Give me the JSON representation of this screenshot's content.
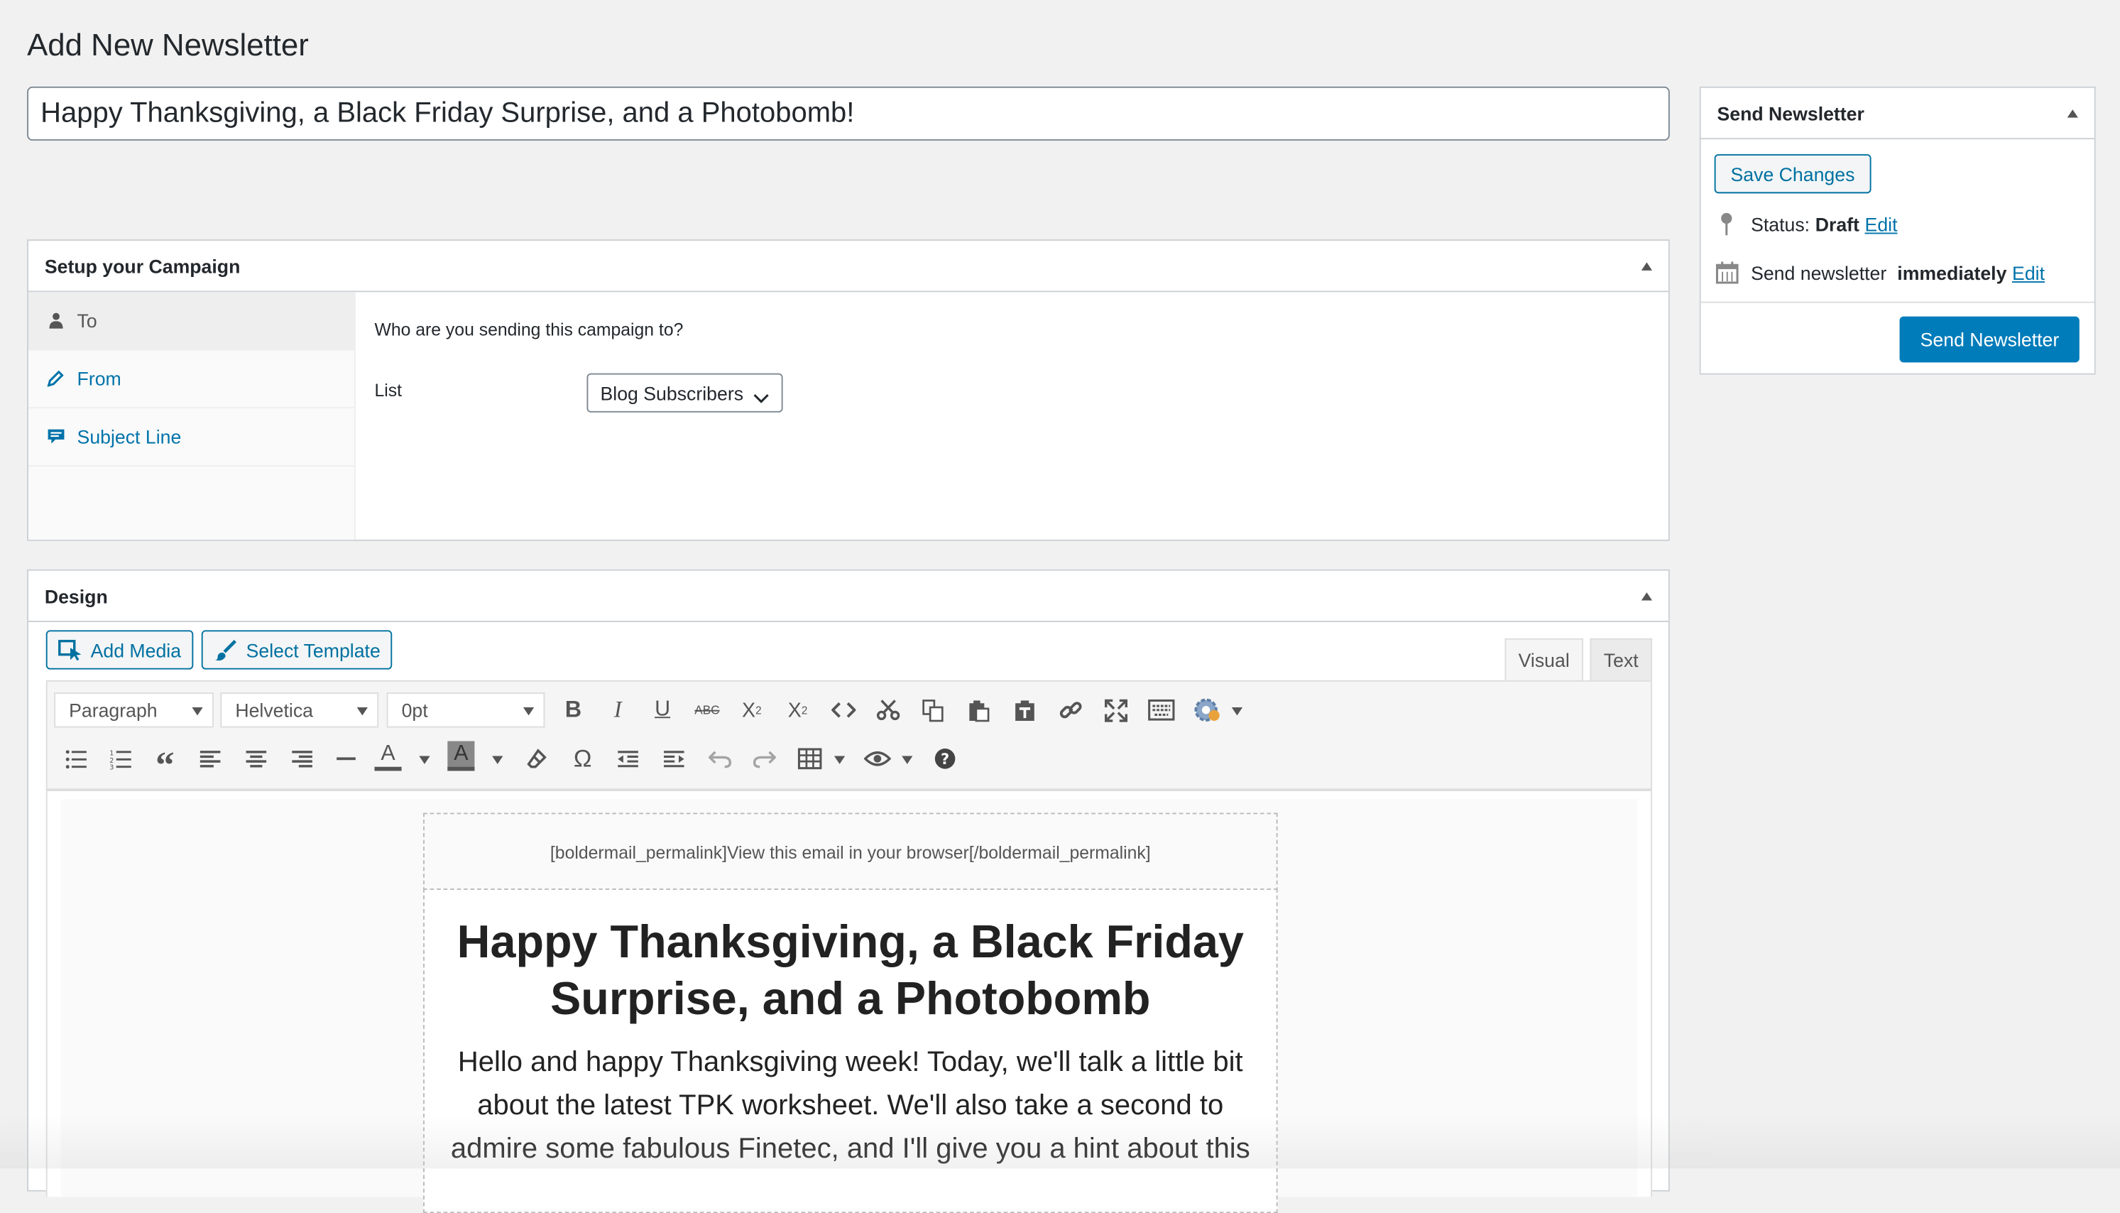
{
  "page": {
    "title": "Add New Newsletter"
  },
  "title_input": {
    "value": "Happy Thanksgiving, a Black Friday Surprise, and a Photobomb!"
  },
  "setup": {
    "heading": "Setup your Campaign",
    "tabs": [
      {
        "label": "To",
        "icon": "person-icon"
      },
      {
        "label": "From",
        "icon": "pencil-icon"
      },
      {
        "label": "Subject Line",
        "icon": "comment-icon"
      }
    ],
    "question": "Who are you sending this campaign to?",
    "list_label": "List",
    "list_value": "Blog Subscribers"
  },
  "design": {
    "heading": "Design",
    "add_media": "Add Media",
    "select_template": "Select Template",
    "tab_visual": "Visual",
    "tab_text": "Text",
    "format_select": "Paragraph",
    "font_select": "Helvetica",
    "size_select": "0pt",
    "email": {
      "header_text": "[boldermail_permalink]View this email in your browser[/boldermail_permalink]",
      "title": "Happy Thanksgiving, a Black Friday Surprise, and a Photobomb",
      "body": "Hello and happy Thanksgiving week! Today, we'll talk a little bit about the latest TPK worksheet. We'll also take a second to admire some fabulous Finetec, and I'll give you a hint about this"
    }
  },
  "send_box": {
    "heading": "Send Newsletter",
    "save_label": "Save Changes",
    "status_label": "Status: ",
    "status_value": "Draft",
    "edit_label": "Edit",
    "schedule_prefix": "Send newsletter ",
    "schedule_value": "immediately",
    "schedule_edit": "Edit",
    "send_label": "Send Newsletter"
  },
  "colors": {
    "accent": "#0073aa",
    "primary_button": "#007cba",
    "background": "#f1f1f1"
  }
}
